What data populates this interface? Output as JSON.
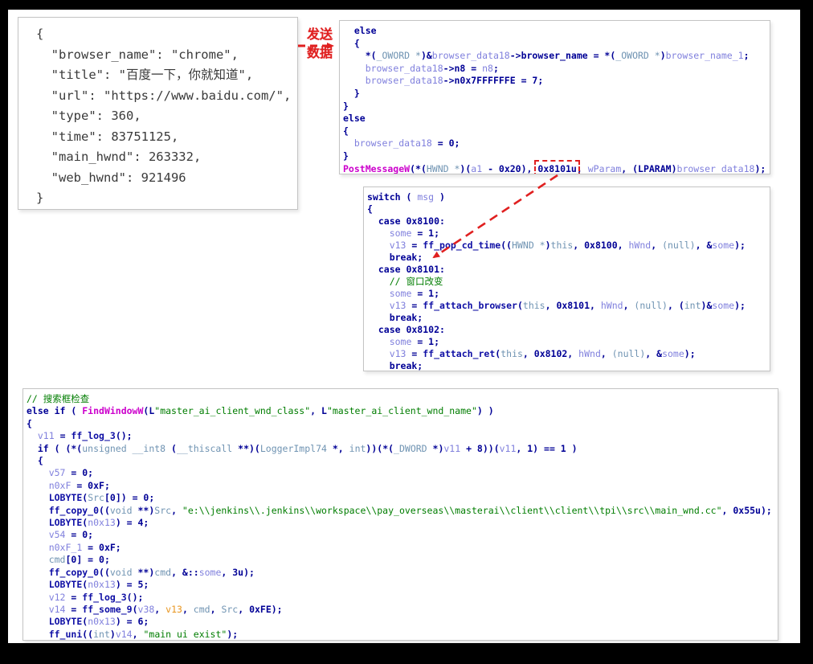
{
  "colors": {
    "frame": "#000000",
    "canvas": "#ffffff",
    "border": "#c4c4c4",
    "navy": "#000096",
    "type": "#6f93b2",
    "var": "#8080dd",
    "func": "#0f0fa5",
    "api": "#cc00cc",
    "str": "#007d00",
    "orange": "#e8951e",
    "red": "#e02020",
    "json-text": "#3a3a3a"
  },
  "send_label": {
    "line1": "发送",
    "line2": "数据"
  },
  "json_panel": {
    "lines": [
      "{",
      "  \"browser_name\": \"chrome\",",
      "  \"title\": \"百度一下，你就知道\",",
      "  \"url\": \"https://www.baidu.com/\",",
      "  \"type\": 360,",
      "  \"time\": 83751125,",
      "  \"main_hwnd\": 263332,",
      "  \"web_hwnd\": 921496",
      "}"
    ]
  },
  "panels": [
    {
      "name": "postmessage-else-branch",
      "lines": [
        [
          [
            "p",
            "  else"
          ]
        ],
        [
          [
            "p",
            "  {"
          ]
        ],
        [
          [
            "p",
            "    *("
          ],
          [
            "t",
            "_OWORD *"
          ],
          [
            "p",
            ")&"
          ],
          [
            "v",
            "browser_data18"
          ],
          [
            "p",
            "->browser_name = *("
          ],
          [
            "t",
            "_OWORD *"
          ],
          [
            "p",
            ")"
          ],
          [
            "v",
            "browser_name_1"
          ],
          [
            "p",
            ";"
          ]
        ],
        [
          [
            "p",
            "    "
          ],
          [
            "v",
            "browser_data18"
          ],
          [
            "p",
            "->n8 = "
          ],
          [
            "v",
            "n8"
          ],
          [
            "p",
            ";"
          ]
        ],
        [
          [
            "p",
            "    "
          ],
          [
            "v",
            "browser_data18"
          ],
          [
            "p",
            "->n0x7FFFFFFE = 7;"
          ]
        ],
        [
          [
            "p",
            "  }"
          ]
        ],
        [
          [
            "p",
            "}"
          ]
        ],
        [
          [
            "p",
            "else"
          ]
        ],
        [
          [
            "p",
            "{"
          ]
        ],
        [
          [
            "p",
            "  "
          ],
          [
            "v",
            "browser_data18"
          ],
          [
            "p",
            " = 0;"
          ]
        ],
        [
          [
            "p",
            "}"
          ]
        ],
        [
          [
            "a",
            "PostMessageW"
          ],
          [
            "p",
            "(*("
          ],
          [
            "t",
            "HWND *"
          ],
          [
            "p",
            ")("
          ],
          [
            "v",
            "a1"
          ],
          [
            "p",
            " - 0x20), "
          ],
          [
            "h",
            "0x8101u"
          ],
          [
            "p",
            ", "
          ],
          [
            "v",
            "wParam"
          ],
          [
            "p",
            ", (LPARAM)"
          ],
          [
            "v",
            "browser_data18"
          ],
          [
            "p",
            ");"
          ]
        ]
      ]
    },
    {
      "name": "message-switch",
      "lines": [
        [
          [
            "p",
            "switch ( "
          ],
          [
            "v",
            "msg"
          ],
          [
            "p",
            " )"
          ]
        ],
        [
          [
            "p",
            "{"
          ]
        ],
        [
          [
            "p",
            "  case 0x8100:"
          ]
        ],
        [
          [
            "p",
            "    "
          ],
          [
            "v",
            "some"
          ],
          [
            "p",
            " = 1;"
          ]
        ],
        [
          [
            "p",
            "    "
          ],
          [
            "v",
            "v13"
          ],
          [
            "p",
            " = "
          ],
          [
            "f",
            "ff_pop_cd_time"
          ],
          [
            "p",
            "(("
          ],
          [
            "t",
            "HWND *"
          ],
          [
            "p",
            ")"
          ],
          [
            "t",
            "this"
          ],
          [
            "p",
            ", 0x8100, "
          ],
          [
            "v",
            "hWnd"
          ],
          [
            "p",
            ", "
          ],
          [
            "t",
            "(null)"
          ],
          [
            "p",
            ", &"
          ],
          [
            "v",
            "some"
          ],
          [
            "p",
            ");"
          ]
        ],
        [
          [
            "p",
            "    break;"
          ]
        ],
        [
          [
            "p",
            "  case 0x8101:"
          ]
        ],
        [
          [
            "s",
            "    // 窗口改变"
          ]
        ],
        [
          [
            "p",
            "    "
          ],
          [
            "v",
            "some"
          ],
          [
            "p",
            " = 1;"
          ]
        ],
        [
          [
            "p",
            "    "
          ],
          [
            "v",
            "v13"
          ],
          [
            "p",
            " = "
          ],
          [
            "f",
            "ff_attach_browser"
          ],
          [
            "p",
            "("
          ],
          [
            "t",
            "this"
          ],
          [
            "p",
            ", 0x8101, "
          ],
          [
            "v",
            "hWnd"
          ],
          [
            "p",
            ", "
          ],
          [
            "t",
            "(null)"
          ],
          [
            "p",
            ", ("
          ],
          [
            "t",
            "int"
          ],
          [
            "p",
            ")&"
          ],
          [
            "v",
            "some"
          ],
          [
            "p",
            ");"
          ]
        ],
        [
          [
            "p",
            "    break;"
          ]
        ],
        [
          [
            "p",
            "  case 0x8102:"
          ]
        ],
        [
          [
            "p",
            "    "
          ],
          [
            "v",
            "some"
          ],
          [
            "p",
            " = 1;"
          ]
        ],
        [
          [
            "p",
            "    "
          ],
          [
            "v",
            "v13"
          ],
          [
            "p",
            " = "
          ],
          [
            "f",
            "ff_attach_ret"
          ],
          [
            "p",
            "("
          ],
          [
            "t",
            "this"
          ],
          [
            "p",
            ", 0x8102, "
          ],
          [
            "v",
            "hWnd"
          ],
          [
            "p",
            ", "
          ],
          [
            "t",
            "(null)"
          ],
          [
            "p",
            ", &"
          ],
          [
            "v",
            "some"
          ],
          [
            "p",
            ");"
          ]
        ],
        [
          [
            "p",
            "    break;"
          ]
        ]
      ]
    },
    {
      "name": "findwindow-check",
      "lines": [
        [
          [
            "s",
            "// 搜索框检查"
          ]
        ],
        [
          [
            "p",
            "else if ( "
          ],
          [
            "a",
            "FindWindowW"
          ],
          [
            "p",
            "(L"
          ],
          [
            "s",
            "\"master_ai_client_wnd_class\""
          ],
          [
            "p",
            ", L"
          ],
          [
            "s",
            "\"master_ai_client_wnd_name\""
          ],
          [
            "p",
            ") )"
          ]
        ],
        [
          [
            "p",
            "{"
          ]
        ],
        [
          [
            "p",
            "  "
          ],
          [
            "v",
            "v11"
          ],
          [
            "p",
            " = "
          ],
          [
            "f",
            "ff_log_3"
          ],
          [
            "p",
            "();"
          ]
        ],
        [
          [
            "p",
            "  if ( (*("
          ],
          [
            "t",
            "unsigned __int8"
          ],
          [
            "p",
            " ("
          ],
          [
            "t",
            "__thiscall"
          ],
          [
            "p",
            " **)("
          ],
          [
            "t",
            "LoggerImpl74"
          ],
          [
            "p",
            " *, "
          ],
          [
            "t",
            "int"
          ],
          [
            "p",
            "))(*("
          ],
          [
            "t",
            "_DWORD"
          ],
          [
            "p",
            " *)"
          ],
          [
            "v",
            "v11"
          ],
          [
            "p",
            " + 8))("
          ],
          [
            "v",
            "v11"
          ],
          [
            "p",
            ", 1) == 1 )"
          ]
        ],
        [
          [
            "p",
            "  {"
          ]
        ],
        [
          [
            "p",
            "    "
          ],
          [
            "v",
            "v57"
          ],
          [
            "p",
            " = 0;"
          ]
        ],
        [
          [
            "p",
            "    "
          ],
          [
            "v",
            "n0xF"
          ],
          [
            "p",
            " = 0xF;"
          ]
        ],
        [
          [
            "p",
            "    "
          ],
          [
            "f",
            "LOBYTE"
          ],
          [
            "p",
            "("
          ],
          [
            "t",
            "Src"
          ],
          [
            "p",
            "[0]) = 0;"
          ]
        ],
        [
          [
            "p",
            "    "
          ],
          [
            "f",
            "ff_copy_0"
          ],
          [
            "p",
            "(("
          ],
          [
            "t",
            "void"
          ],
          [
            "p",
            " **)"
          ],
          [
            "t",
            "Src"
          ],
          [
            "p",
            ", "
          ],
          [
            "s",
            "\"e:\\\\jenkins\\\\.jenkins\\\\workspace\\\\pay_overseas\\\\masterai\\\\client\\\\client\\\\tpi\\\\src\\\\main_wnd.cc\""
          ],
          [
            "p",
            ", 0x55u);"
          ]
        ],
        [
          [
            "p",
            "    "
          ],
          [
            "f",
            "LOBYTE"
          ],
          [
            "p",
            "("
          ],
          [
            "v",
            "n0x13"
          ],
          [
            "p",
            ") = 4;"
          ]
        ],
        [
          [
            "p",
            "    "
          ],
          [
            "v",
            "v54"
          ],
          [
            "p",
            " = 0;"
          ]
        ],
        [
          [
            "p",
            "    "
          ],
          [
            "v",
            "n0xF_1"
          ],
          [
            "p",
            " = 0xF;"
          ]
        ],
        [
          [
            "p",
            "    "
          ],
          [
            "t",
            "cmd"
          ],
          [
            "p",
            "[0] = 0;"
          ]
        ],
        [
          [
            "p",
            "    "
          ],
          [
            "f",
            "ff_copy_0"
          ],
          [
            "p",
            "(("
          ],
          [
            "t",
            "void"
          ],
          [
            "p",
            " **)"
          ],
          [
            "t",
            "cmd"
          ],
          [
            "p",
            ", &::"
          ],
          [
            "v",
            "some"
          ],
          [
            "p",
            ", 3u);"
          ]
        ],
        [
          [
            "p",
            "    "
          ],
          [
            "f",
            "LOBYTE"
          ],
          [
            "p",
            "("
          ],
          [
            "v",
            "n0x13"
          ],
          [
            "p",
            ") = 5;"
          ]
        ],
        [
          [
            "p",
            "    "
          ],
          [
            "v",
            "v12"
          ],
          [
            "p",
            " = "
          ],
          [
            "f",
            "ff_log_3"
          ],
          [
            "p",
            "();"
          ]
        ],
        [
          [
            "p",
            "    "
          ],
          [
            "v",
            "v14"
          ],
          [
            "p",
            " = "
          ],
          [
            "f",
            "ff_some_9"
          ],
          [
            "p",
            "("
          ],
          [
            "v",
            "v38"
          ],
          [
            "p",
            ", "
          ],
          [
            "o",
            "v13"
          ],
          [
            "p",
            ", "
          ],
          [
            "t",
            "cmd"
          ],
          [
            "p",
            ", "
          ],
          [
            "t",
            "Src"
          ],
          [
            "p",
            ", 0xFE);"
          ]
        ],
        [
          [
            "p",
            "    "
          ],
          [
            "f",
            "LOBYTE"
          ],
          [
            "p",
            "("
          ],
          [
            "v",
            "n0x13"
          ],
          [
            "p",
            ") = 6;"
          ]
        ],
        [
          [
            "p",
            "    "
          ],
          [
            "f",
            "ff_uni"
          ],
          [
            "p",
            "(("
          ],
          [
            "t",
            "int"
          ],
          [
            "p",
            ")"
          ],
          [
            "v",
            "v14"
          ],
          [
            "p",
            ", "
          ],
          [
            "s",
            "\"main ui exist\""
          ],
          [
            "p",
            ");"
          ]
        ]
      ]
    }
  ]
}
